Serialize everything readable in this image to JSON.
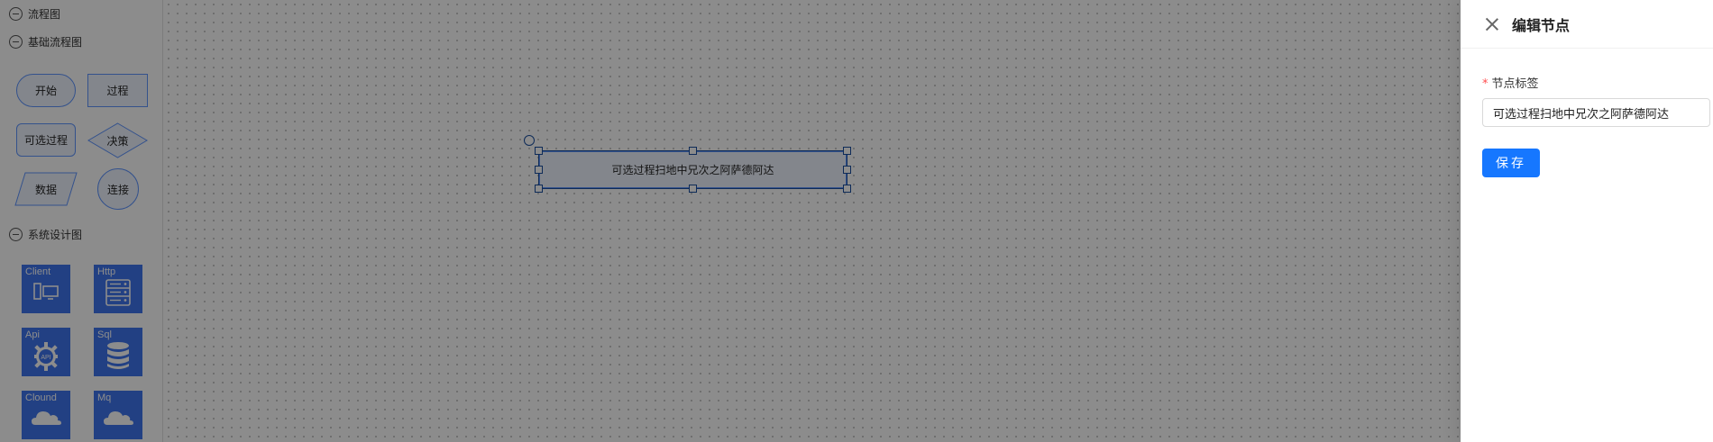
{
  "sidebar": {
    "groups": [
      {
        "title": "流程图"
      },
      {
        "title": "基础流程图"
      },
      {
        "title": "系统设计图"
      }
    ],
    "basic_shapes": [
      {
        "label": "开始",
        "icon": "terminator-shape"
      },
      {
        "label": "过程",
        "icon": "rectangle-shape"
      },
      {
        "label": "可选过程",
        "icon": "rounded-rectangle-shape"
      },
      {
        "label": "决策",
        "icon": "diamond-shape"
      },
      {
        "label": "数据",
        "icon": "parallelogram-shape"
      },
      {
        "label": "连接",
        "icon": "circle-shape"
      }
    ],
    "system_tiles": [
      {
        "label": "Client",
        "icon": "client-device-icon"
      },
      {
        "label": "Http",
        "icon": "server-rack-icon"
      },
      {
        "label": "Api",
        "icon": "api-gear-icon"
      },
      {
        "label": "Sql",
        "icon": "database-icon"
      },
      {
        "label": "Clound",
        "icon": "cloud-icon"
      },
      {
        "label": "Mq",
        "icon": "cloud-icon"
      }
    ]
  },
  "canvas": {
    "selected_node": {
      "label": "可选过程扫地中兄次之阿萨德阿达"
    }
  },
  "drawer": {
    "title": "编辑节点",
    "field_label": "节点标签",
    "required_mark": "*",
    "field_value": "可选过程扫地中兄次之阿萨德阿达",
    "save_label": "保存"
  },
  "colors": {
    "shape_stroke": "#5f95ff",
    "shape_fill": "#eff4ff",
    "tile_fill": "#3f76ef",
    "primary_button": "#1677ff",
    "required": "#ff4d4f"
  }
}
